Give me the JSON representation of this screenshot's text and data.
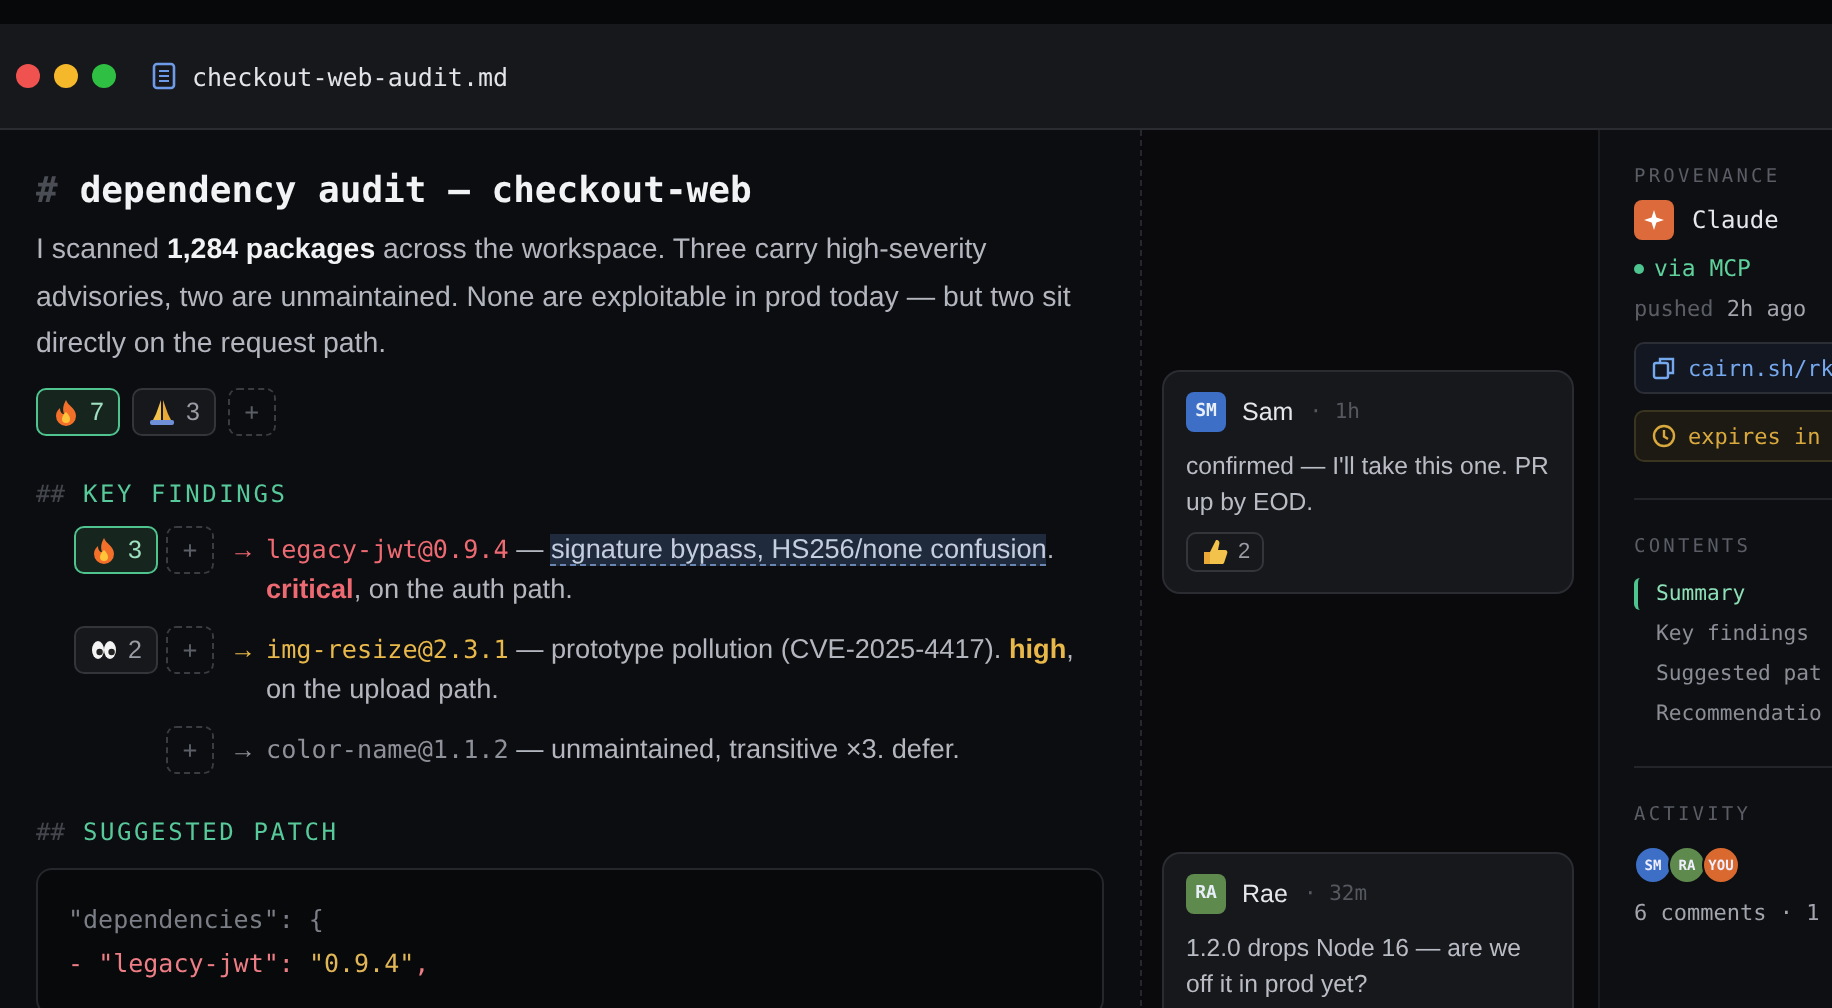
{
  "window": {
    "title": "checkout-web-audit.md"
  },
  "document": {
    "heading_mark": "#",
    "heading": "dependency audit — checkout-web",
    "intro": "I scanned **1,284 packages** across the workspace. Three carry high-severity advisories, two are unmaintained. None are exploitable in prod today — but two sit directly on the request path.",
    "reactions": [
      {
        "kind": "fire",
        "count": "7",
        "selected": true
      },
      {
        "kind": "pray",
        "count": "3",
        "selected": false
      }
    ],
    "add_label": "+"
  },
  "findings_section": {
    "mark": "##",
    "title": "KEY FINDINGS",
    "findings": [
      {
        "reactions": [
          {
            "kind": "fire",
            "count": "3",
            "selected": true
          }
        ],
        "add_label": "+",
        "arrow": "→",
        "kind": "critical",
        "package": "legacy-jwt@0.9.4",
        "segments": [
          {
            "kind": "plain",
            "text": " — "
          },
          {
            "kind": "highlight",
            "text": "signature bypass, HS256/none confusion"
          },
          {
            "kind": "plain",
            "text": ". "
          },
          {
            "kind": "severity",
            "text": "critical"
          },
          {
            "kind": "plain",
            "text": ", on the auth path."
          }
        ]
      },
      {
        "reactions": [
          {
            "kind": "eyes",
            "count": "2",
            "selected": false
          }
        ],
        "add_label": "+",
        "arrow": "→",
        "kind": "high",
        "package": "img-resize@2.3.1",
        "segments": [
          {
            "kind": "plain",
            "text": " — prototype pollution (CVE-2025-4417). "
          },
          {
            "kind": "severity",
            "text": "high"
          },
          {
            "kind": "plain",
            "text": ", on the upload path."
          }
        ]
      },
      {
        "add_label": "+",
        "arrow": "→",
        "kind": "low",
        "package": "color-name@1.1.2",
        "segments": [
          {
            "kind": "plain",
            "text": " — unmaintained, transitive ×3. defer."
          }
        ]
      }
    ]
  },
  "patch_section": {
    "mark": "##",
    "title": "SUGGESTED PATCH",
    "lines": [
      {
        "kind": "context",
        "tokens": [
          {
            "kind": "key",
            "text": "\"dependencies\""
          },
          {
            "kind": "punct",
            "text": ": {"
          }
        ]
      },
      {
        "kind": "removed",
        "tokens": [
          {
            "kind": "punct",
            "text": "- "
          },
          {
            "kind": "key",
            "text": "\"legacy-jwt\""
          },
          {
            "kind": "punct",
            "text": ": "
          },
          {
            "kind": "value",
            "text": "\"0.9.4\""
          },
          {
            "kind": "punct",
            "text": ","
          }
        ]
      }
    ]
  },
  "comments": [
    {
      "initials": "SM",
      "color": "#3d6fc6",
      "author": "Sam",
      "time": "· 1h",
      "text": "confirmed — I'll take this one. PR up by EOD.",
      "reactions": [
        {
          "kind": "thumbs",
          "count": "2",
          "selected": false
        }
      ]
    },
    {
      "initials": "RA",
      "color": "#5e8a4e",
      "author": "Rae",
      "time": "· 32m",
      "text": "1.2.0 drops Node 16 — are we off it in prod yet?"
    }
  ],
  "sidebar": {
    "provenance": {
      "label": "PROVENANCE",
      "agent": "Claude",
      "via": "via MCP",
      "pushed_label": "pushed",
      "pushed_time": "2h ago",
      "link": "cairn.sh/rk",
      "expires": "expires in"
    },
    "contents": {
      "label": "CONTENTS",
      "items": [
        {
          "label": "Summary",
          "selected": true
        },
        {
          "label": "Key findings",
          "selected": false
        },
        {
          "label": "Suggested pat",
          "selected": false
        },
        {
          "label": "Recommendatio",
          "selected": false
        }
      ]
    },
    "activity": {
      "label": "ACTIVITY",
      "avatars": [
        {
          "initials": "SM",
          "color": "#3d6fc6"
        },
        {
          "initials": "RA",
          "color": "#5e8a4e"
        },
        {
          "initials": "YOU",
          "color": "#d9692e"
        }
      ],
      "summary": "6 comments · 1"
    }
  }
}
